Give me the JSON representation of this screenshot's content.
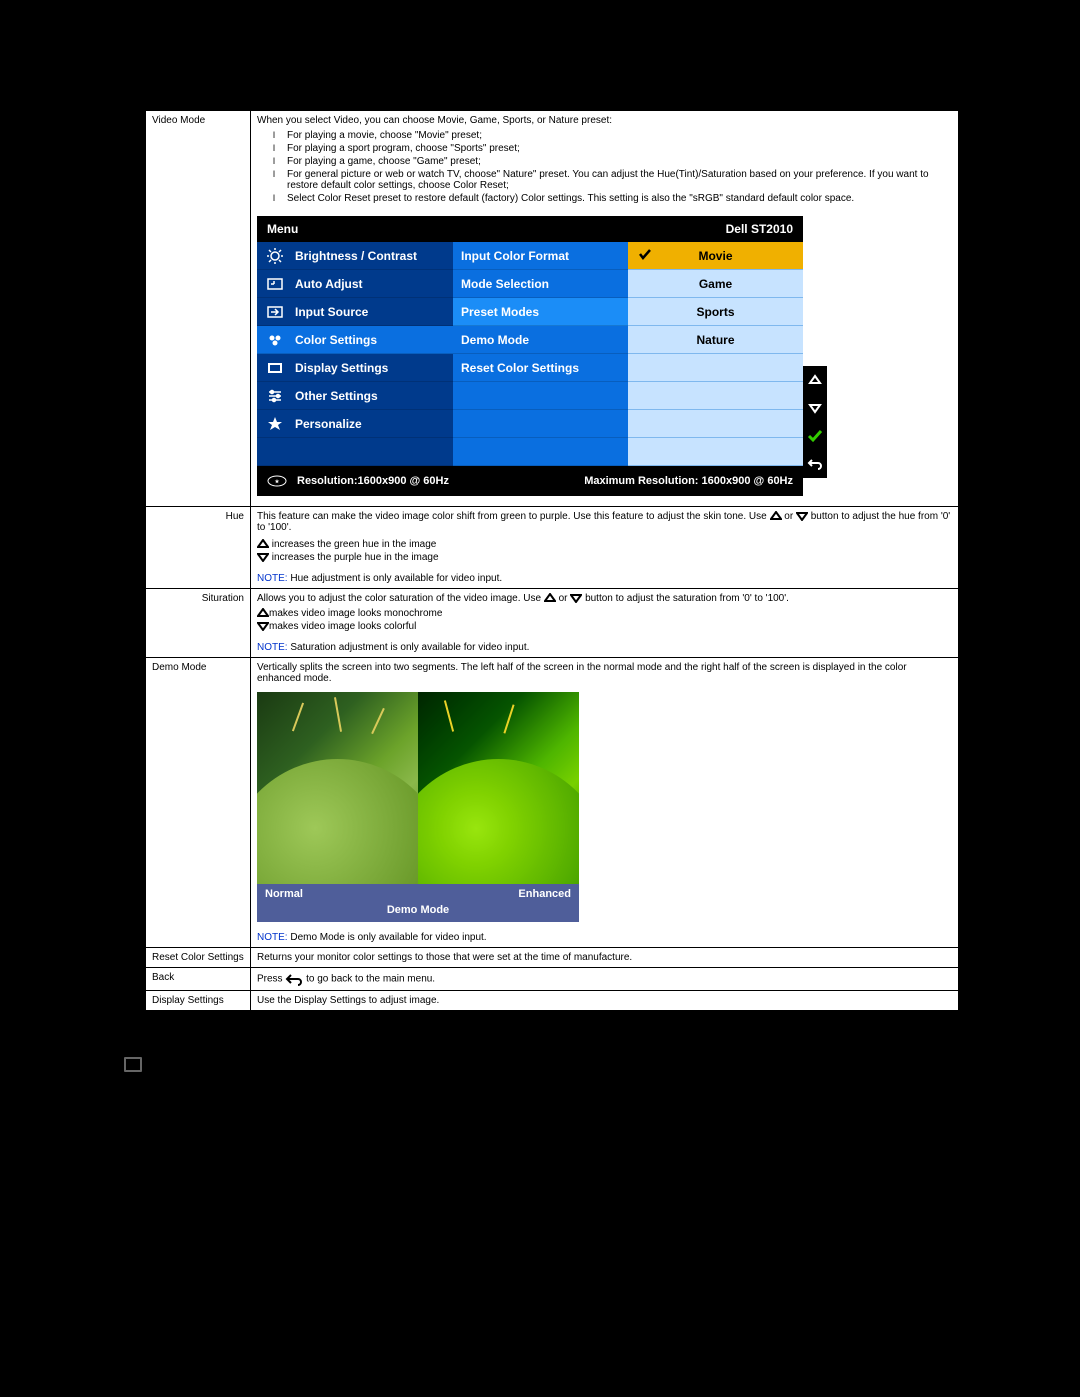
{
  "rows": {
    "videoMode": {
      "label": "Video Mode",
      "intro": "When you select Video, you can choose Movie, Game, Sports, or Nature preset:",
      "bullets": [
        "For playing a movie, choose \"Movie\" preset;",
        "For playing a sport program, choose \"Sports\" preset;",
        "For playing a game, choose \"Game\" preset;",
        "For general picture or web or watch TV, choose\" Nature\" preset. You can adjust the Hue(Tint)/Saturation based on your preference. If you want to restore default color settings, choose Color Reset;",
        "Select Color Reset preset to restore default (factory) Color settings. This setting is also the \"sRGB\" standard default color space."
      ]
    },
    "hue": {
      "label": "Hue",
      "text1a": "This feature can make the video image color shift from green to purple. Use this feature to adjust the skin tone. Use",
      "text1b": " or ",
      "text1c": " button to adjust the hue from '0' to '100'.",
      "line2": " increases the green hue in the image",
      "line3": " increases the purple hue in the image",
      "noteLabel": "NOTE:",
      "noteText": " Hue adjustment is only available for video input."
    },
    "saturation": {
      "label": "Situration",
      "text1a": "Allows you to adjust the color saturation of the video image. Use ",
      "text1b": " or ",
      "text1c": " button to adjust the saturation from '0' to '100'.",
      "line2": "makes video image looks monochrome",
      "line3": "makes video image looks colorful",
      "noteLabel": "NOTE:",
      "noteText": " Saturation adjustment is only available for video input."
    },
    "demoMode": {
      "label": "Demo Mode",
      "text": "Vertically splits the screen into two segments. The left half of the screen in the normal mode and the right half of the screen is displayed in the color enhanced mode.",
      "noteLabel": "NOTE:",
      "noteText": " Demo Mode is only available for video input.",
      "overlay": {
        "left": "Normal",
        "right": "Enhanced",
        "title": "Demo  Mode"
      }
    },
    "resetColor": {
      "label": "Reset Color Settings",
      "text": "Returns your monitor color settings to those that were set at the time of manufacture."
    },
    "back": {
      "label": "Back",
      "pre": "Press ",
      "post": " to go back to the main menu."
    },
    "displaySettings": {
      "label": "Display Settings",
      "text": "Use the Display Settings to adjust image."
    }
  },
  "osd": {
    "menu": "Menu",
    "model": "Dell ST2010",
    "col1": [
      {
        "label": "Brightness / Contrast",
        "icon": "sun"
      },
      {
        "label": "Auto Adjust",
        "icon": "auto"
      },
      {
        "label": "Input Source",
        "icon": "input"
      },
      {
        "label": "Color Settings",
        "icon": "palette",
        "selected": true
      },
      {
        "label": "Display Settings",
        "icon": "rect"
      },
      {
        "label": "Other Settings",
        "icon": "sliders"
      },
      {
        "label": "Personalize",
        "icon": "star"
      }
    ],
    "col2": [
      {
        "label": "Input Color Format"
      },
      {
        "label": "Mode Selection"
      },
      {
        "label": "Preset Modes",
        "selected": true
      },
      {
        "label": "Demo Mode"
      },
      {
        "label": "Reset Color Settings"
      }
    ],
    "col3": [
      {
        "label": "Movie",
        "selected": true
      },
      {
        "label": "Game"
      },
      {
        "label": "Sports"
      },
      {
        "label": "Nature"
      }
    ],
    "footer": {
      "res1_label": "Resolution:",
      "res1_value": "1600x900 @ 60Hz",
      "res2_label": "Maximum Resolution:",
      "res2_value": " 1600x900 @ 60Hz"
    }
  }
}
